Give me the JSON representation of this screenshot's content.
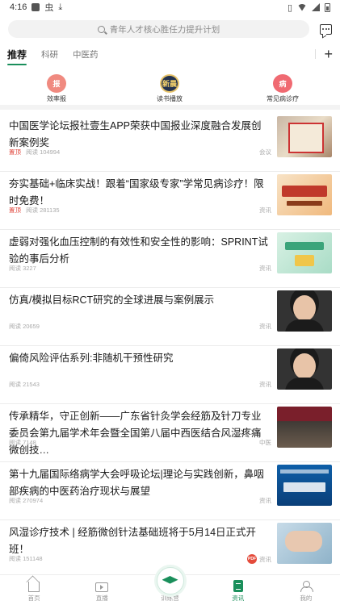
{
  "status_bar": {
    "time": "4:16",
    "notif_glyph": "虫"
  },
  "search": {
    "placeholder": "青年人才核心胜任力提升计划"
  },
  "tabs": [
    {
      "label": "推荐",
      "active": true
    },
    {
      "label": "科研",
      "active": false
    },
    {
      "label": "中医药",
      "active": false
    }
  ],
  "quick_links": [
    {
      "label": "效率报",
      "icon_text": "报"
    },
    {
      "label": "读书播放",
      "icon_text": "新晨"
    },
    {
      "label": "常见病诊疗",
      "icon_text": "病"
    }
  ],
  "feed": [
    {
      "title": "中国医学论坛报社壹生APP荣获中国报业深度融合发展创新案例奖",
      "tag": "置顶",
      "views": "阅读 104994",
      "category": "会议",
      "thumb": "certificate"
    },
    {
      "title": "夯实基础+临床实战！跟着“国家级专家”学常见病诊疗！限时免费！",
      "tag": "置顶",
      "views": "阅读 281135",
      "category": "资讯",
      "thumb": "course-poster"
    },
    {
      "title": "虚弱对强化血压控制的有效性和安全性的影响：SPRINT试验的事后分析",
      "tag": "",
      "views": "阅读 3227",
      "category": "资讯",
      "thumb": "green-poster"
    },
    {
      "title": "仿真/模拟目标RCT研究的全球进展与案例展示",
      "tag": "",
      "views": "阅读 20659",
      "category": "资讯",
      "thumb": "portrait"
    },
    {
      "title": "偏倚风险评估系列:非随机干预性研究",
      "tag": "",
      "views": "阅读 21543",
      "category": "资讯",
      "thumb": "portrait"
    },
    {
      "title": "传承精华，守正创新——广东省针灸学会经筋及针刀专业委员会第九届学术年会暨全国第八届中西医结合风湿疼痛微创技…",
      "tag": "",
      "views": "阅读 7148",
      "category": "中医",
      "thumb": "meeting"
    },
    {
      "title": "第十九届国际络病学大会呼吸论坛|理论与实践创新，鼻咽部疾病的中医药治疗现状与展望",
      "tag": "",
      "views": "阅读 270974",
      "category": "资讯",
      "thumb": "forum-poster"
    },
    {
      "title": "风湿诊疗技术 | 经筋微创针法基础班将于5月14日正式开班！",
      "tag": "",
      "views": "阅读 151148",
      "category": "资讯",
      "thumb": "hands",
      "pdf": "PDF"
    }
  ],
  "bottom_nav": [
    {
      "label": "首页",
      "icon": "home-icon",
      "active": false
    },
    {
      "label": "直播",
      "icon": "live-icon",
      "active": false
    },
    {
      "label": "训练营",
      "icon": "graduation-cap-icon",
      "active": false
    },
    {
      "label": "资讯",
      "icon": "document-icon",
      "active": true
    },
    {
      "label": "我的",
      "icon": "user-icon",
      "active": false
    }
  ],
  "colors": {
    "accent": "#1a8f5b",
    "tag_red": "#e0473d"
  }
}
